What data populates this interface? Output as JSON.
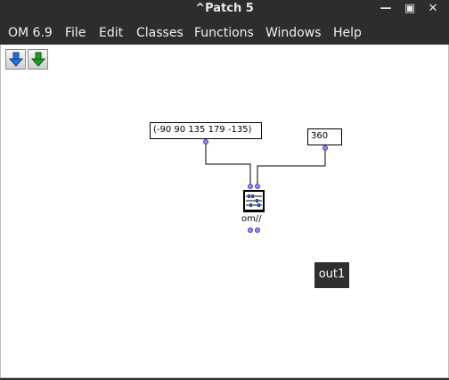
{
  "window": {
    "title": "^Patch 5",
    "controls": [
      "minimize-icon",
      "maximize-icon",
      "close-icon"
    ]
  },
  "menubar": {
    "items": [
      "OM 6.9",
      "File",
      "Edit",
      "Classes",
      "Functions",
      "Windows",
      "Help"
    ]
  },
  "toolbar": {
    "buttons": [
      "arrow-down-blue-icon",
      "arrow-down-green-icon"
    ]
  },
  "patch": {
    "list_box": "(-90 90 135 179 -135)",
    "number_box": "360",
    "function_box": {
      "name": "om//",
      "icon": "abacus-icon"
    },
    "output_box": "out1"
  },
  "colors": {
    "chrome": "#2d2d2d",
    "canvas": "#ffffff",
    "inlet": "#8f8ff0",
    "output_box": "#2f2f2f"
  }
}
